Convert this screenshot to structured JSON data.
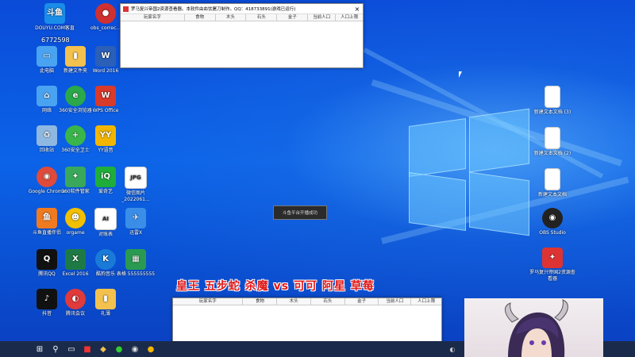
{
  "desktop_icons": [
    {
      "id": "douyu",
      "label": "DOUYU.COM客直",
      "glyph": "斗鱼",
      "color": "#1a8de8"
    },
    {
      "id": "obs_correct",
      "label": "obs_correc...",
      "glyph": "●",
      "color": "#d03030"
    },
    {
      "id": "number",
      "label": "6772598"
    },
    {
      "id": "this_pc",
      "label": "此电脑",
      "glyph": "▭",
      "color": "#4aa3f0"
    },
    {
      "id": "new_folder",
      "label": "新建文件夹",
      "glyph": "▮",
      "color": "#f2c14e"
    },
    {
      "id": "word",
      "label": "Word 2016",
      "glyph": "W",
      "color": "#2b5fb8"
    },
    {
      "id": "network",
      "label": "网络",
      "glyph": "⌂",
      "color": "#4aa3f0"
    },
    {
      "id": "browser360",
      "label": "360安全浏览器",
      "glyph": "e",
      "color": "#2aa84a"
    },
    {
      "id": "wps",
      "label": "WPS Office",
      "glyph": "W",
      "color": "#d83a2b"
    },
    {
      "id": "recycle",
      "label": "回收站",
      "glyph": "♻",
      "color": "#8fb8e0"
    },
    {
      "id": "guard360",
      "label": "360安全卫士",
      "glyph": "+",
      "color": "#3ab54a"
    },
    {
      "id": "yy",
      "label": "YY语音",
      "glyph": "YY",
      "color": "#f2b600"
    },
    {
      "id": "chrome",
      "label": "Google Chrome",
      "glyph": "◉",
      "color": "#e04a3a"
    },
    {
      "id": "soft360",
      "label": "360软件管家",
      "glyph": "✦",
      "color": "#3aa85a"
    },
    {
      "id": "iqiyi",
      "label": "爱奇艺",
      "glyph": "iQ",
      "color": "#1fae3a"
    },
    {
      "id": "jpg",
      "label": "微信图片_2022061...",
      "glyph": "JPG",
      "color": "#cfd8e3"
    },
    {
      "id": "douyu_helper",
      "label": "斗鱼直播伴侣",
      "glyph": "鱼",
      "color": "#f07a20"
    },
    {
      "id": "orgame",
      "label": "orgame",
      "glyph": "☻",
      "color": "#f2c000"
    },
    {
      "id": "contract",
      "label": "对账表",
      "glyph": "AI",
      "color": "#eeeeee"
    },
    {
      "id": "feishu",
      "label": "迅雷X",
      "glyph": "✈",
      "color": "#3a8ee8"
    },
    {
      "id": "qq",
      "label": "腾讯QQ",
      "glyph": "Q",
      "color": "#111111"
    },
    {
      "id": "excel",
      "label": "Excel 2016",
      "glyph": "X",
      "color": "#1e7a45"
    },
    {
      "id": "kugou",
      "label": "酷狗音乐",
      "glyph": "K",
      "color": "#1a7ad8"
    },
    {
      "id": "sheet",
      "label": "表格 555555555",
      "glyph": "▦",
      "color": "#2a9a52"
    },
    {
      "id": "tiktok",
      "label": "抖音",
      "glyph": "♪",
      "color": "#111111"
    },
    {
      "id": "tencent_meeting",
      "label": "腾讯会议",
      "glyph": "◐",
      "color": "#e03a3a"
    },
    {
      "id": "folder2",
      "label": "礼薄",
      "glyph": "▮",
      "color": "#f2c14e"
    }
  ],
  "right_icons": [
    {
      "id": "txt1",
      "label": "新建文本文档 (3)"
    },
    {
      "id": "txt2",
      "label": "新建文本文档 (2)"
    },
    {
      "id": "txt3",
      "label": "新建文本文档"
    },
    {
      "id": "obs",
      "label": "OBS Studio"
    },
    {
      "id": "rome",
      "label": "罗马复兴帝国2资源查看器"
    }
  ],
  "top_window": {
    "title": "罗马复兴帝国2资源查看器。本软件由血饮屠刀制作。QQ：418733891(游戏已运行)",
    "columns": [
      "玩家名字",
      "食物",
      "木头",
      "石头",
      "金子",
      "当前人口",
      "人口上限"
    ]
  },
  "bottom_window": {
    "columns": [
      "玩家名字",
      "食物",
      "木头",
      "石头",
      "金子",
      "当前人口",
      "人口上限"
    ]
  },
  "tooltip": "斗鱼平台开播成功",
  "banner": "皇王 五步蛇 杀魔 vs 可可 阿星 草莓",
  "colors": {
    "accent": "#e01818",
    "desktop": "#0b63e8",
    "taskbar": "#1a2a4a"
  }
}
